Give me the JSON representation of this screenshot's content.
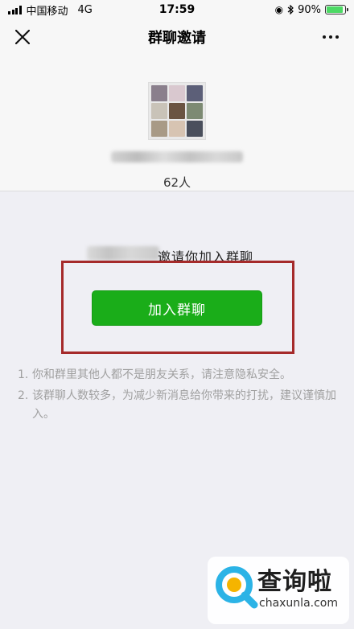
{
  "status_bar": {
    "carrier": "中国移动",
    "network": "4G",
    "time": "17:59",
    "battery": "90%",
    "battery_level": 0.9
  },
  "nav": {
    "title": "群聊邀请",
    "close_icon": "close-icon",
    "more_icon": "more-dots-icon"
  },
  "group": {
    "member_count": "62人",
    "avatar_tile_colors": [
      "#8a7f8c",
      "#d9c8cf",
      "#5c5f78",
      "#c9c3b8",
      "#6a5442",
      "#7d8a73",
      "#a89a86",
      "#d7c4b2",
      "#4a4f5c"
    ]
  },
  "invite": {
    "text": "邀请你加入群聊"
  },
  "join_button": {
    "label": "加入群聊",
    "color": "#1aad19"
  },
  "highlight_color": "#a52a2a",
  "notes": [
    {
      "num": "1.",
      "text": "你和群里其他人都不是朋友关系，请注意隐私安全。"
    },
    {
      "num": "2.",
      "text": "该群聊人数较多，为减少新消息给你带来的打扰，建议谨慎加入。"
    }
  ],
  "watermark": {
    "name": "查询啦",
    "domain": "chaxunla.com",
    "colors": [
      "#2bb3e6",
      "#f5b400"
    ]
  }
}
